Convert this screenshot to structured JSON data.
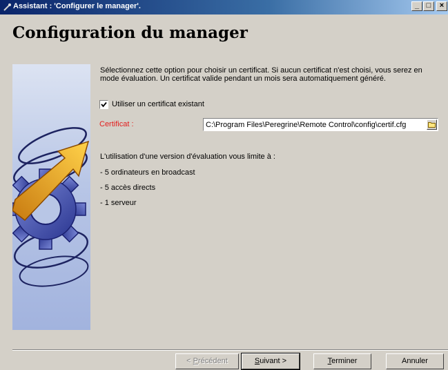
{
  "window": {
    "title": "Assistant : 'Configurer le manager'.",
    "minimize": "_",
    "maximize": "□",
    "close": "×"
  },
  "page": {
    "heading": "Configuration du manager",
    "description": "Sélectionnez cette option pour choisir un certificat. Si aucun certificat n'est choisi, vous serez en mode évaluation. Un certificat valide pendant un mois sera automatiquement généré."
  },
  "certificate_option": {
    "checkbox_label": "Utiliser un certificat existant",
    "checked": true,
    "field_label": "Certificat :",
    "field_value": "C:\\Program Files\\Peregrine\\Remote Control\\config\\certif.cfg"
  },
  "evaluation": {
    "intro": "L'utilisation d'une version d'évaluation vous limite à :",
    "limits": [
      "- 5 ordinateurs en broadcast",
      "- 5 accès directs",
      "- 1 serveur"
    ]
  },
  "buttons": {
    "previous": {
      "prefix": "< ",
      "mnemonic": "P",
      "rest": "récédent",
      "enabled": false
    },
    "next": {
      "prefix": "",
      "mnemonic": "S",
      "rest": "uivant >",
      "enabled": true
    },
    "finish": {
      "prefix": "",
      "mnemonic": "T",
      "rest": "erminer",
      "enabled": true
    },
    "cancel": {
      "label": "Annuler",
      "enabled": true
    }
  },
  "colors": {
    "title_bar": "#0a246a",
    "dialog_bg": "#d4d0c8",
    "required_label": "#e31c1c"
  },
  "icons": {
    "window": "wizard-icon",
    "browse": "folder-icon",
    "checkbox": "checkmark-icon",
    "illustration": "gear-arrow-illustration"
  }
}
